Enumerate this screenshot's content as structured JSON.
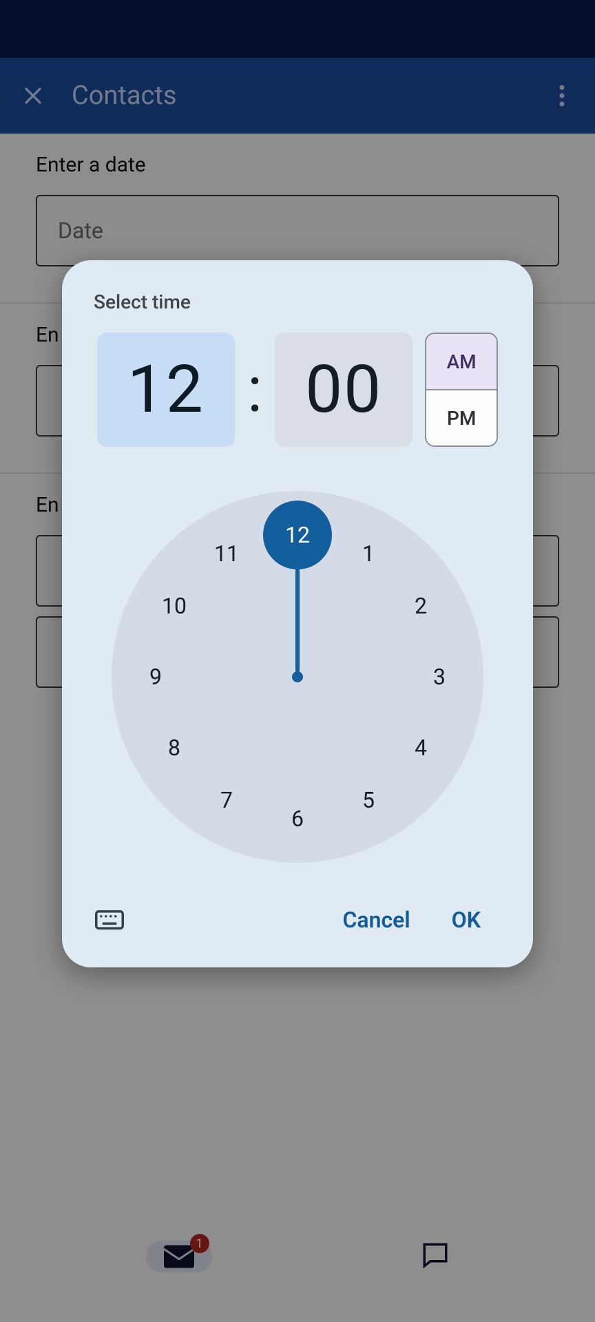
{
  "appbar": {
    "title": "Contacts"
  },
  "fields": {
    "date_label": "Enter a date",
    "date_placeholder": "Date",
    "f2_label": "En",
    "f3_label": "En"
  },
  "bottomnav": {
    "badge": "1"
  },
  "dialog": {
    "title": "Select time",
    "hour": "12",
    "minute": "00",
    "am": "AM",
    "pm": "PM",
    "hours": {
      "h1": "1",
      "h2": "2",
      "h3": "3",
      "h4": "4",
      "h5": "5",
      "h6": "6",
      "h7": "7",
      "h8": "8",
      "h9": "9",
      "h10": "10",
      "h11": "11",
      "h12": "12"
    },
    "selected_hour": "12",
    "cancel": "Cancel",
    "ok": "OK"
  }
}
